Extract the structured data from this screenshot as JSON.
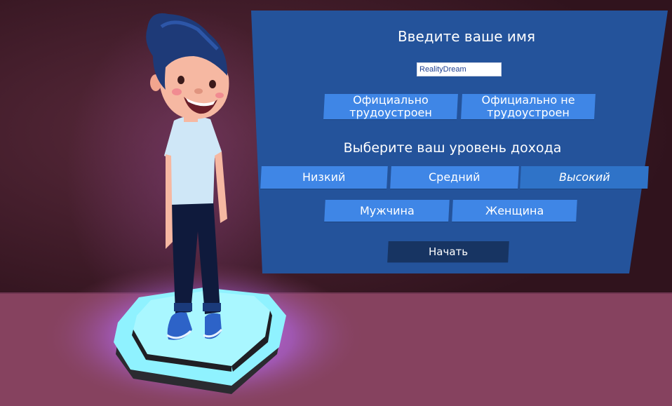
{
  "panel": {
    "name_title": "Введите ваше имя",
    "name_input_value": "RealityDream",
    "employment": {
      "official": "Официально трудоустроен",
      "unofficial": "Официально не трудоустроен"
    },
    "income_title": "Выберите ваш уровень дохода",
    "income": {
      "low": "Низкий",
      "medium": "Средний",
      "high": "Высокий"
    },
    "gender": {
      "male": "Мужчина",
      "female": "Женщина"
    },
    "start_label": "Начать"
  },
  "colors": {
    "panel_bg": "#24539b",
    "button": "#3f86e6",
    "button_dark": "#173462",
    "wall": "#3a1824",
    "floor": "#86425f",
    "platform": "#8ff2ff",
    "glow": "#c070ff"
  },
  "icons": [
    "character-avatar",
    "character-pedestal"
  ]
}
